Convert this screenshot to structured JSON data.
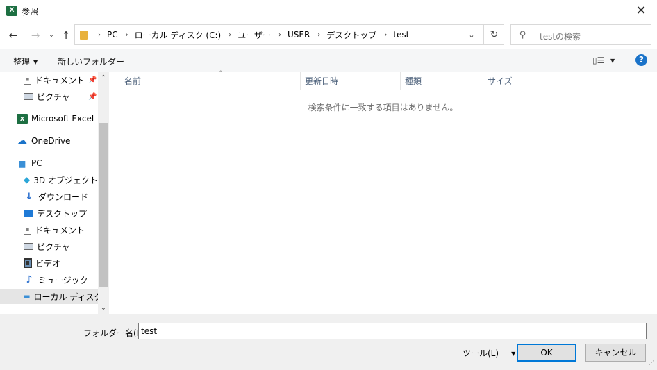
{
  "window": {
    "title": "参照",
    "app_icon_letter": "X"
  },
  "address": {
    "crumbs": [
      "PC",
      "ローカル ディスク (C:)",
      "ユーザー",
      "USER",
      "デスクトップ",
      "test"
    ],
    "search_placeholder": "testの検索"
  },
  "toolbar": {
    "organize": "整理",
    "new_folder": "新しいフォルダー"
  },
  "nav": {
    "items": [
      {
        "label": "ドキュメント",
        "icon": "document-icon",
        "pinned": true
      },
      {
        "label": "ピクチャ",
        "icon": "picture-icon",
        "pinned": true
      },
      {
        "label": "Microsoft Excel",
        "icon": "excel-icon"
      },
      {
        "label": "OneDrive",
        "icon": "cloud-icon"
      },
      {
        "label": "PC",
        "icon": "pc-icon"
      },
      {
        "label": "3D オブジェクト",
        "icon": "cube-icon"
      },
      {
        "label": "ダウンロード",
        "icon": "download-icon"
      },
      {
        "label": "デスクトップ",
        "icon": "desktop-icon"
      },
      {
        "label": "ドキュメント",
        "icon": "document-icon"
      },
      {
        "label": "ピクチャ",
        "icon": "picture-icon"
      },
      {
        "label": "ビデオ",
        "icon": "video-icon"
      },
      {
        "label": "ミュージック",
        "icon": "music-icon"
      },
      {
        "label": "ローカル ディスク (C",
        "icon": "drive-icon",
        "selected": true
      }
    ]
  },
  "list": {
    "columns": [
      "名前",
      "更新日時",
      "種類",
      "サイズ"
    ],
    "empty_message": "検索条件に一致する項目はありません。"
  },
  "bottom": {
    "filename_label": "フォルダー名(N):",
    "filename_value": "test",
    "tools_label": "ツール(L)",
    "ok_label": "OK",
    "cancel_label": "キャンセル"
  },
  "colors": {
    "accent": "#0078d7",
    "excel_green": "#1d6f42",
    "help_blue": "#1a73c9"
  }
}
